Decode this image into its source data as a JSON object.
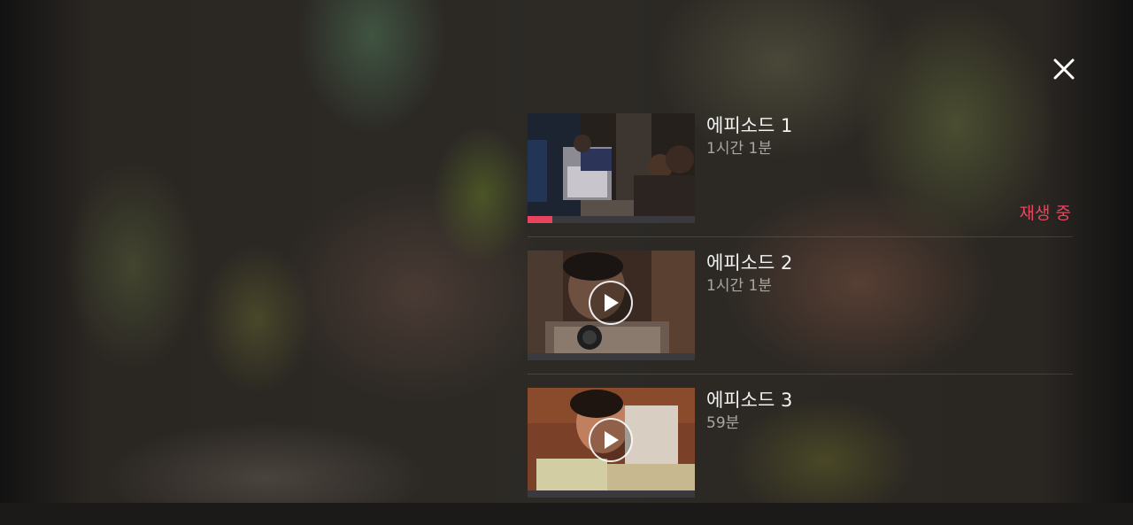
{
  "close": {
    "label": "close-icon"
  },
  "episodes": [
    {
      "title": "에피소드 1",
      "duration": "1시간 1분",
      "status": "재생 중",
      "progress": 0.15,
      "playing": true
    },
    {
      "title": "에피소드 2",
      "duration": "1시간 1분",
      "status": "",
      "progress": 0,
      "playing": false
    },
    {
      "title": "에피소드 3",
      "duration": "59분",
      "status": "",
      "progress": 0,
      "playing": false
    }
  ],
  "colors": {
    "accent": "#e9445f",
    "text": "#f2f2f2",
    "subtext": "#a9a6a2"
  }
}
